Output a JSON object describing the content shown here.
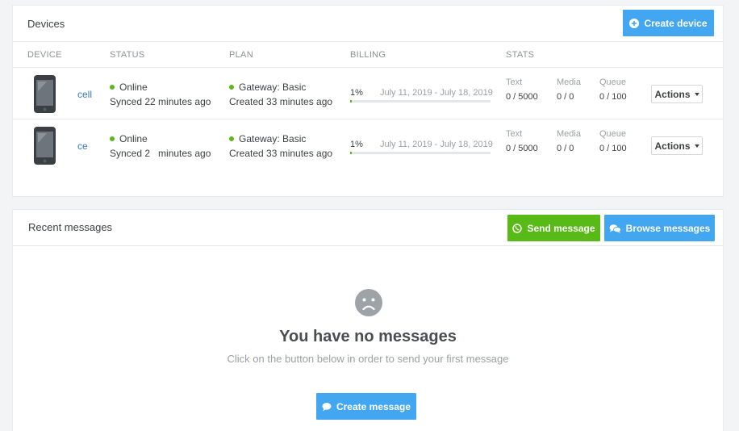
{
  "devices_panel": {
    "title": "Devices",
    "create_button": "Create device",
    "columns": [
      "DEVICE",
      "STATUS",
      "PLAN",
      "BILLING",
      "STATS"
    ],
    "rows": [
      {
        "name": "cell",
        "status": "Online",
        "synced": "Synced 22 minutes ago",
        "plan": "Gateway: Basic",
        "created": "Created 33 minutes ago",
        "billing_pct": "1%",
        "billing_fraction": 0.01,
        "billing_range": "July 11, 2019 - July 18, 2019",
        "stats": [
          {
            "label": "Text",
            "value": "0 / 5000"
          },
          {
            "label": "Media",
            "value": "0 / 0"
          },
          {
            "label": "Queue",
            "value": "0 / 100"
          }
        ],
        "actions_label": "Actions"
      },
      {
        "name": "ce",
        "status": "Online",
        "synced": "Synced 2   minutes ago",
        "plan": "Gateway: Basic",
        "created": "Created 33 minutes ago",
        "billing_pct": "1%",
        "billing_fraction": 0.01,
        "billing_range": "July 11, 2019 - July 18, 2019",
        "stats": [
          {
            "label": "Text",
            "value": "0 / 5000"
          },
          {
            "label": "Media",
            "value": "0 / 0"
          },
          {
            "label": "Queue",
            "value": "0 / 100"
          }
        ],
        "actions_label": "Actions"
      }
    ]
  },
  "messages_panel": {
    "title": "Recent messages",
    "send_button": "Send message",
    "browse_button": "Browse messages",
    "empty_icon": "sad-face-icon",
    "empty_title": "You have no messages",
    "empty_subtitle": "Click on the button below in order to send your first message",
    "create_button": "Create message"
  },
  "colors": {
    "primary": "#42a6f0",
    "success": "#58ba16",
    "link": "#3a7bc8"
  }
}
